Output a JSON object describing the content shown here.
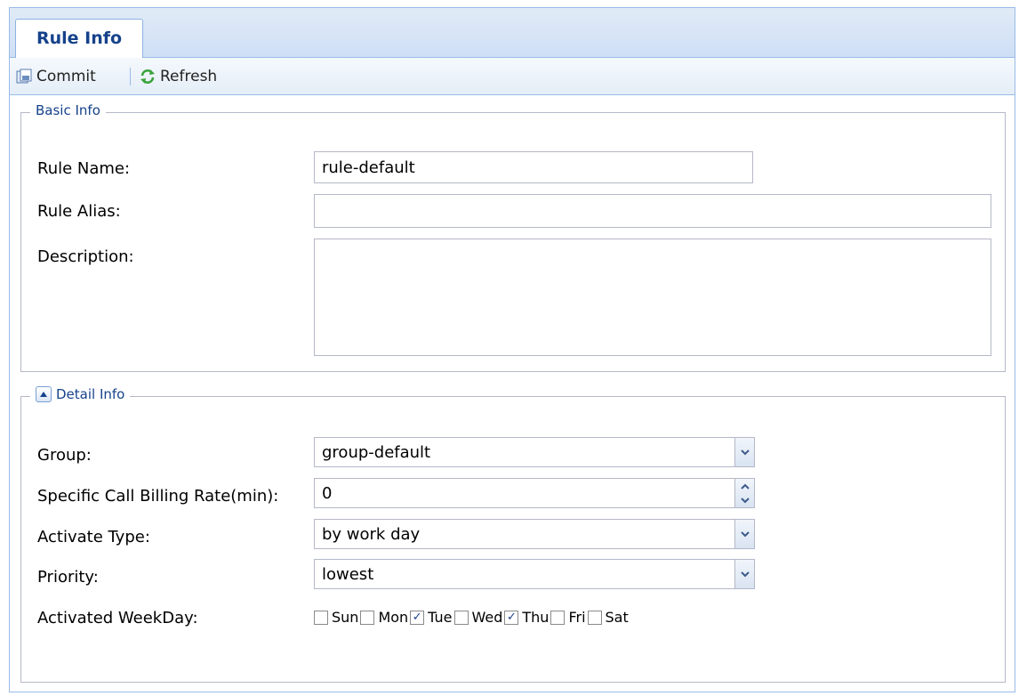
{
  "tab": {
    "title": "Rule Info"
  },
  "toolbar": {
    "commit_label": "Commit",
    "refresh_label": "Refresh"
  },
  "basic": {
    "legend": "Basic Info",
    "rule_name_label": "Rule Name:",
    "rule_name_value": "rule-default",
    "rule_alias_label": "Rule Alias:",
    "rule_alias_value": "",
    "description_label": "Description:",
    "description_value": ""
  },
  "detail": {
    "legend": "Detail Info",
    "group_label": "Group:",
    "group_value": "group-default",
    "billing_label": "Specific Call Billing Rate(min):",
    "billing_value": "0",
    "activate_label": "Activate Type:",
    "activate_value": "by work day",
    "priority_label": "Priority:",
    "priority_value": "lowest",
    "weekday_label": "Activated WeekDay:",
    "weekdays": [
      {
        "label": "Sun",
        "checked": false
      },
      {
        "label": "Mon",
        "checked": false
      },
      {
        "label": "Tue",
        "checked": true
      },
      {
        "label": "Wed",
        "checked": false
      },
      {
        "label": "Thu",
        "checked": true
      },
      {
        "label": "Fri",
        "checked": false
      },
      {
        "label": "Sat",
        "checked": false
      }
    ]
  }
}
